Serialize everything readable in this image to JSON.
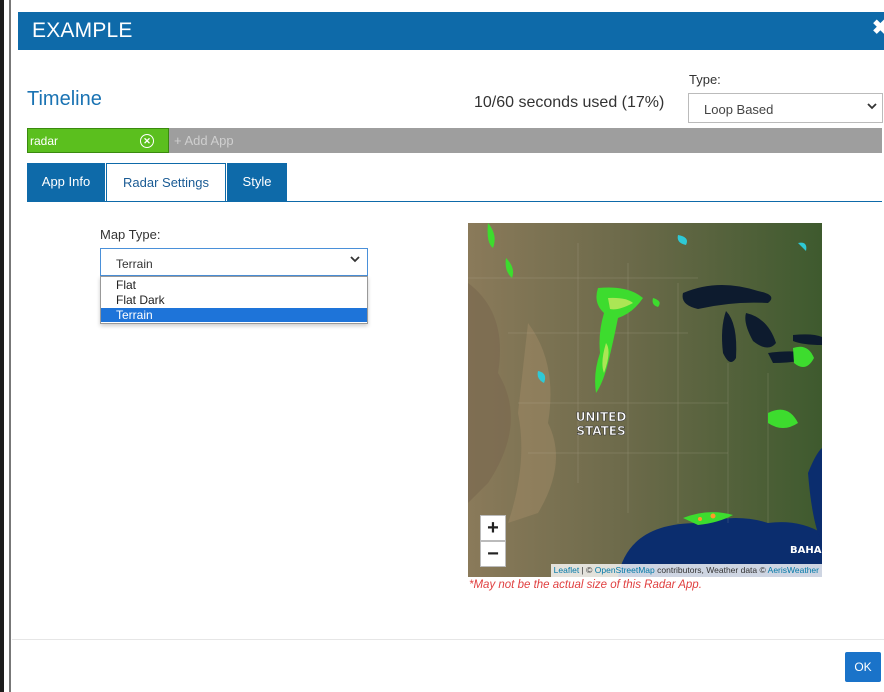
{
  "modal": {
    "title": "EXAMPLE",
    "close_glyph": "✖"
  },
  "timeline": {
    "title": "Timeline",
    "usage": "10/60 seconds used (17%)"
  },
  "type": {
    "label": "Type:",
    "value": "Loop Based"
  },
  "apps": {
    "chip_label": "radar",
    "add_label": "+ Add App"
  },
  "tabs": [
    {
      "label": "App Info"
    },
    {
      "label": "Radar Settings"
    },
    {
      "label": "Style"
    }
  ],
  "active_tab": "Radar Settings",
  "map_type": {
    "label": "Map Type:",
    "value": "Terrain",
    "options": [
      "Flat",
      "Flat Dark",
      "Terrain"
    ],
    "selected_option": "Terrain"
  },
  "map": {
    "place_label_line1": "UNITED",
    "place_label_line2": "STATES",
    "edge_label": "BAHA",
    "zoom_in": "+",
    "zoom_out": "−",
    "attribution": {
      "leaflet": "Leaflet",
      "sep1": " | © ",
      "osm": "OpenStreetMap",
      "mid": " contributors, Weather data © ",
      "aeris": "AerisWeather"
    }
  },
  "disclaimer": "*May not be the actual size of this Radar App.",
  "footer": {
    "ok_label": "OK"
  },
  "colors": {
    "header": "#0e6aa9",
    "chip": "#5bbf1e",
    "ok_button": "#1a73c9",
    "disclaimer": "#e04040"
  },
  "icons": {
    "close": "close-icon",
    "chip_remove": "circle-x-icon",
    "dropdown": "chevron-down-icon"
  }
}
